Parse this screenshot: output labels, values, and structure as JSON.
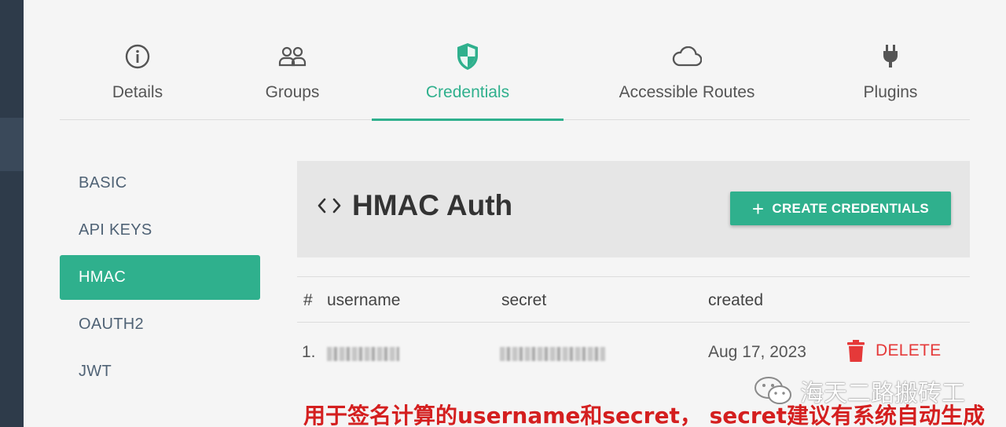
{
  "tabs": [
    {
      "label": "Details",
      "icon": "info-icon",
      "active": false
    },
    {
      "label": "Groups",
      "icon": "users-icon",
      "active": false
    },
    {
      "label": "Credentials",
      "icon": "shield-icon",
      "active": true
    },
    {
      "label": "Accessible Routes",
      "icon": "cloud-icon",
      "active": false
    },
    {
      "label": "Plugins",
      "icon": "plug-icon",
      "active": false
    }
  ],
  "sidebar": {
    "items": [
      {
        "label": "BASIC"
      },
      {
        "label": "API KEYS"
      },
      {
        "label": "HMAC"
      },
      {
        "label": "OAUTH2"
      },
      {
        "label": "JWT"
      }
    ],
    "active_index": 2
  },
  "panel": {
    "title": "HMAC Auth",
    "title_icon": "code-icon",
    "create_button": "CREATE CREDENTIALS"
  },
  "table": {
    "columns": [
      "#",
      "username",
      "secret",
      "created"
    ],
    "rows": [
      {
        "index": "1.",
        "username": "",
        "secret": "",
        "created": "Aug 17, 2023",
        "action": "DELETE"
      }
    ]
  },
  "watermark": "海天二路搬砖工",
  "annotation": "用于签名计算的username和secret， secret建议有系统自动生成",
  "colors": {
    "accent": "#2fb08d",
    "danger": "#e53939",
    "rail": "#2e3b4a",
    "annotation": "#d41f1f"
  }
}
